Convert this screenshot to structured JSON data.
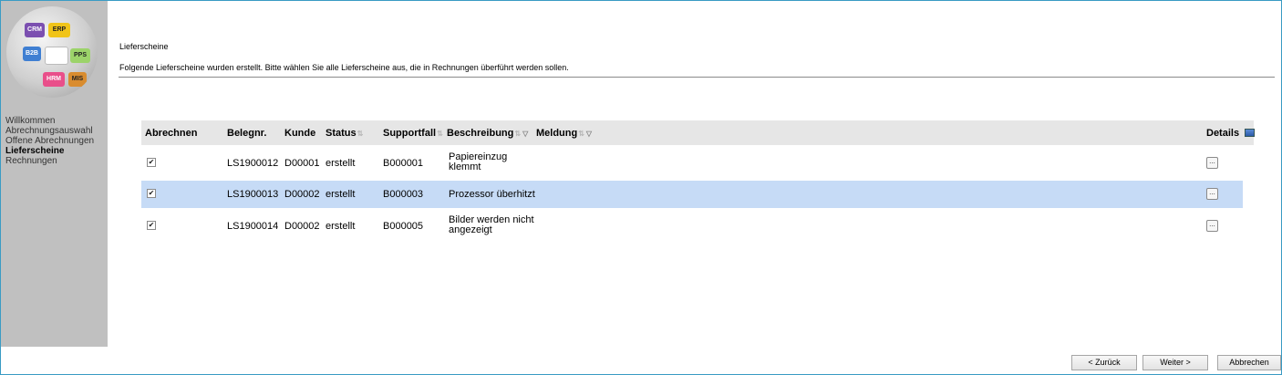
{
  "logo": {
    "labels": [
      "CRM",
      "ERP",
      "B2B",
      "PPS",
      "HRM",
      "MIS"
    ],
    "colors": [
      "#7b4fb0",
      "#f0c419",
      "#3f7fd2",
      "#9cd36a",
      "#e94f8a",
      "#d98c2f"
    ]
  },
  "sidebar": {
    "items": [
      {
        "label": "Willkommen",
        "active": false
      },
      {
        "label": "Abrechnungsauswahl",
        "active": false
      },
      {
        "label": "Offene Abrechnungen",
        "active": false
      },
      {
        "label": "Lieferscheine",
        "active": true
      },
      {
        "label": "Rechnungen",
        "active": false
      }
    ]
  },
  "page": {
    "heading": "Lieferscheine",
    "instruction": "Folgende Lieferscheine wurden erstellt. Bitte wählen Sie alle Lieferscheine aus, die in Rechnungen überführt werden sollen."
  },
  "table": {
    "headers": {
      "abrechnen": "Abrechnen",
      "belegnr": "Belegnr.",
      "kunde": "Kunde",
      "status": "Status",
      "supportfall": "Supportfall",
      "beschreibung": "Beschreibung",
      "meldung": "Meldung",
      "details": "Details"
    },
    "rows": [
      {
        "checked": true,
        "belegnr": "LS1900012",
        "kunde": "D00001",
        "status": "erstellt",
        "supportfall": "B000001",
        "beschreibung": "Papiereinzug klemmt",
        "details": "...",
        "selected": false
      },
      {
        "checked": true,
        "belegnr": "LS1900013",
        "kunde": "D00002",
        "status": "erstellt",
        "supportfall": "B000003",
        "beschreibung": "Prozessor überhitzt",
        "details": "...",
        "selected": true
      },
      {
        "checked": true,
        "belegnr": "LS1900014",
        "kunde": "D00002",
        "status": "erstellt",
        "supportfall": "B000005",
        "beschreibung": "Bilder werden nicht angezeigt",
        "details": "...",
        "selected": false
      }
    ],
    "selected_row_color": "#c6dbf6",
    "header_bg": "#e6e6e6"
  },
  "footer": {
    "back_label": "< Zurück",
    "next_label": "Weiter >",
    "cancel_label": "Abbrechen"
  },
  "colors": {
    "sidebar_bg": "#c0c0c0",
    "frame_border": "#3a9bc4"
  }
}
